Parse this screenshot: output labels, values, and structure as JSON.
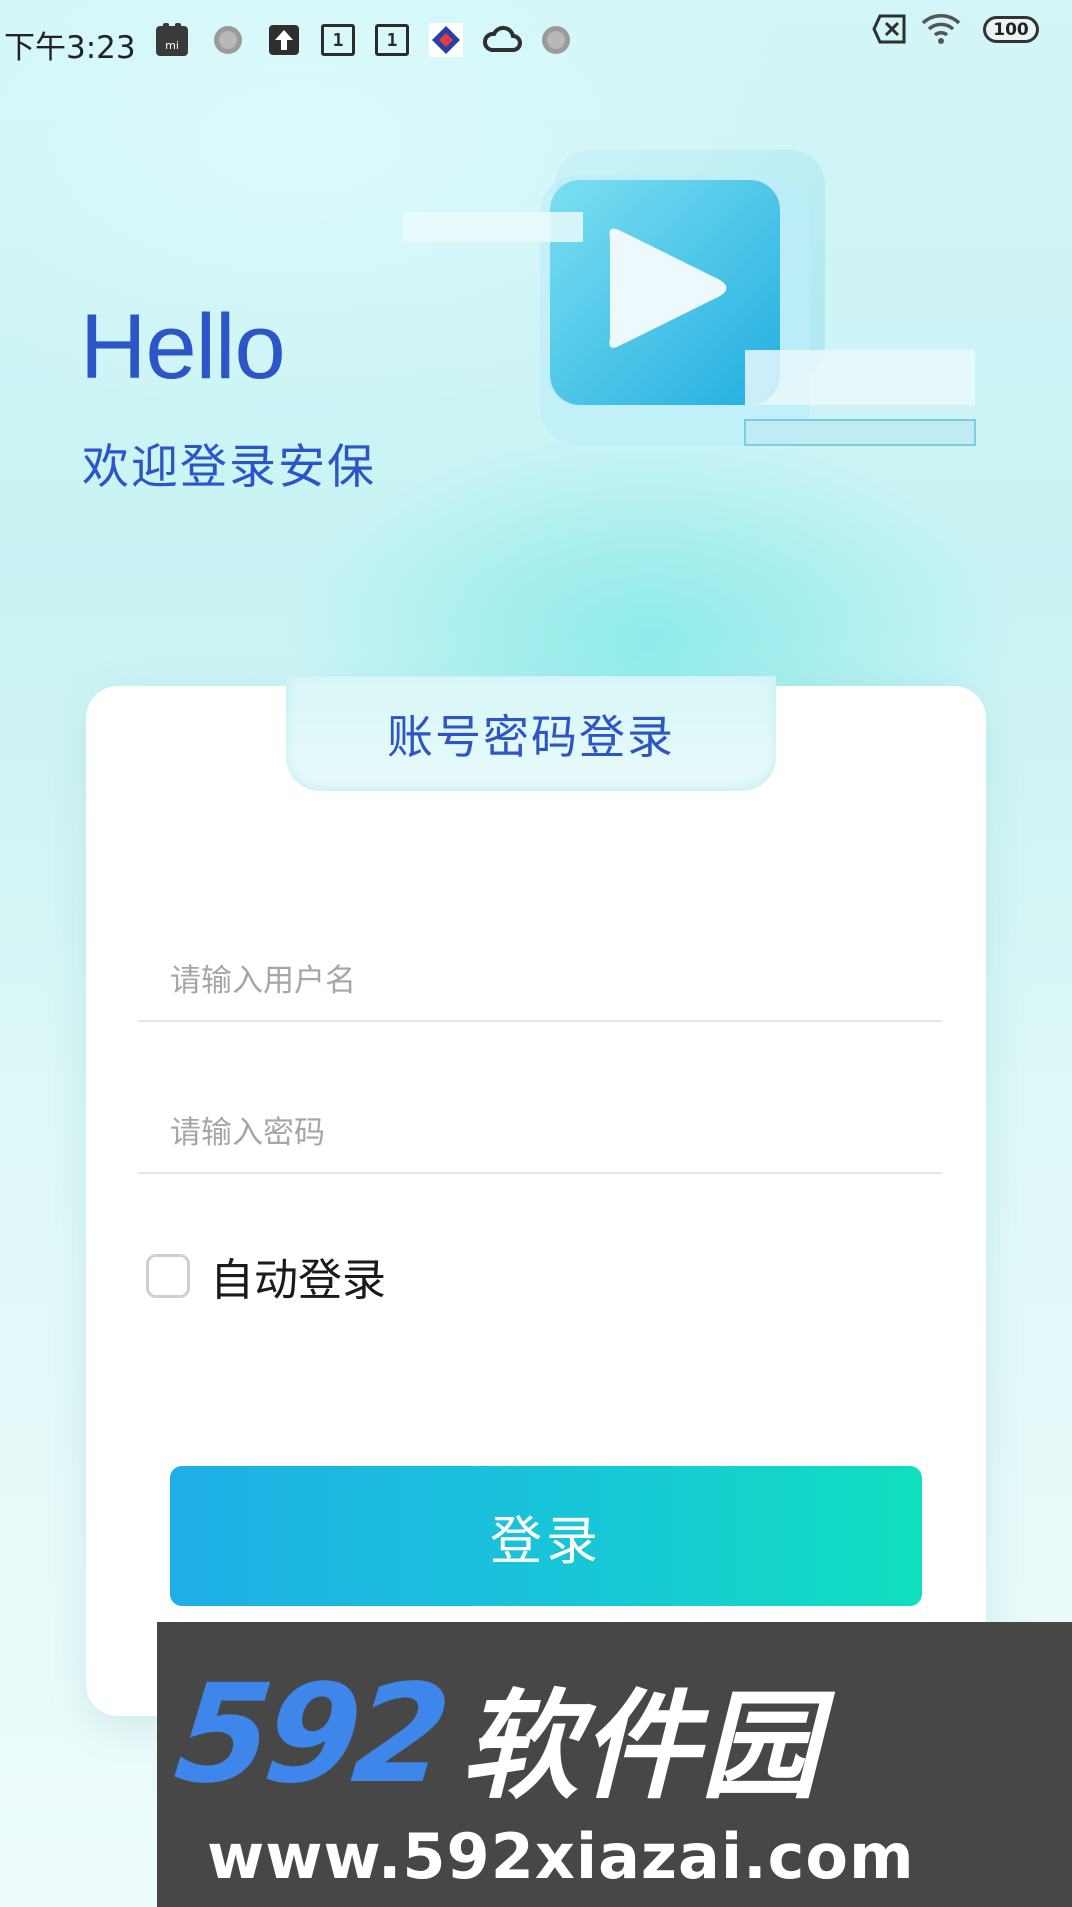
{
  "status_bar": {
    "time": "下午3:23",
    "battery": "100",
    "notification_icons": [
      "mi-icon",
      "dot-icon",
      "upload-icon",
      "calendar-icon",
      "calendar-icon",
      "app-icon",
      "cloud-icon",
      "dot-icon"
    ],
    "calendar_day": "1"
  },
  "hero": {
    "greeting": "Hello",
    "welcome": "欢迎登录安保",
    "illustration_icon": "video-play-icon"
  },
  "login": {
    "tab_title": "账号密码登录",
    "username_placeholder": "请输入用户名",
    "username_value": "",
    "password_placeholder": "请输入密码",
    "password_value": "",
    "auto_login_label": "自动登录",
    "auto_login_checked": false,
    "submit_label": "登录"
  },
  "watermark": {
    "logo_digits": "592",
    "logo_text": "软件园",
    "url": "www.592xiazai.com"
  },
  "colors": {
    "accent": "#2c56c8",
    "button_start": "#1faee6",
    "button_end": "#10dfbf",
    "background": "#d3f6f8"
  }
}
